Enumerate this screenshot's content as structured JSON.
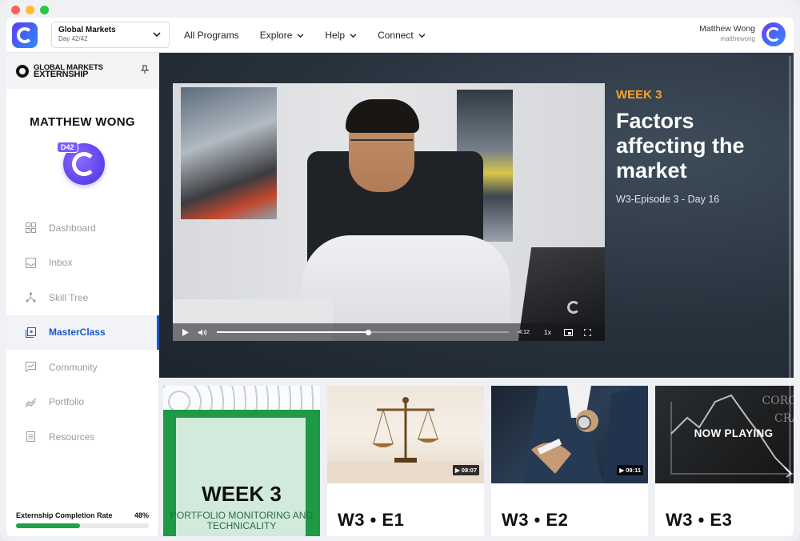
{
  "window": {
    "traffic_lights": [
      "#fe5f57",
      "#febc2e",
      "#28c840"
    ]
  },
  "topbar": {
    "program": {
      "name": "Global Markets",
      "day": "Day 42/42"
    },
    "nav": [
      {
        "label": "All Programs",
        "dropdown": false
      },
      {
        "label": "Explore",
        "dropdown": true
      },
      {
        "label": "Help",
        "dropdown": true
      },
      {
        "label": "Connect",
        "dropdown": true
      }
    ],
    "user": {
      "name": "Matthew Wong",
      "handle": "matthewong"
    }
  },
  "sidebar": {
    "brand_line1": "GLOBAL MARKETS",
    "brand_line2": "EXTERNSHIP",
    "profile_name": "MATTHEW WONG",
    "badge": "D42",
    "items": [
      {
        "label": "Dashboard",
        "icon": "dashboard-icon",
        "active": false
      },
      {
        "label": "Inbox",
        "icon": "inbox-icon",
        "active": false
      },
      {
        "label": "Skill Tree",
        "icon": "skill-tree-icon",
        "active": false
      },
      {
        "label": "MasterClass",
        "icon": "masterclass-icon",
        "active": true
      },
      {
        "label": "Community",
        "icon": "community-icon",
        "active": false
      },
      {
        "label": "Portfolio",
        "icon": "portfolio-icon",
        "active": false
      },
      {
        "label": "Resources",
        "icon": "resources-icon",
        "active": false
      }
    ],
    "completion": {
      "label": "Externship Completion Rate",
      "value": "48%",
      "fraction": 0.48,
      "color": "#1ea24a"
    }
  },
  "player": {
    "time_remaining": "-4:12",
    "speed": "1x",
    "progress": 0.52
  },
  "episode": {
    "week": "WEEK 3",
    "title": "Factors affecting the market",
    "subtitle": "W3-Episode 3 - Day 16",
    "accent": "#f6a425"
  },
  "cards": [
    {
      "type": "week",
      "title": "WEEK 3",
      "subtitle": "PORTFOLIO MONITORING AND TECHNICALITY"
    },
    {
      "type": "episode",
      "title": "W3 • E1",
      "duration": "▶ 08:07",
      "thumb": "scales"
    },
    {
      "type": "episode",
      "title": "W3 • E2",
      "duration": "▶ 09:11",
      "thumb": "hands"
    },
    {
      "type": "episode",
      "title": "W3 • E3",
      "duration": "▶",
      "thumb": "chalk",
      "overlay": "NOW PLAYING",
      "chalk_text": "CORON\nCRAS"
    }
  ]
}
